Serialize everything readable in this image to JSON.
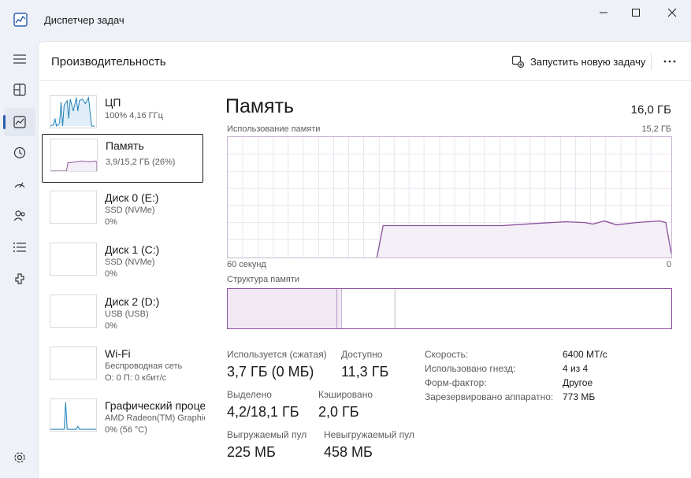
{
  "window": {
    "title": "Диспетчер задач"
  },
  "header": {
    "title": "Производительность",
    "run_task": "Запустить новую задачу"
  },
  "perf_list": [
    {
      "name": "ЦП",
      "sub1": "100%  4,16 ГГц",
      "sub2": ""
    },
    {
      "name": "Память",
      "sub1": "3,9/15,2 ГБ (26%)",
      "sub2": ""
    },
    {
      "name": "Диск 0 (E:)",
      "sub1": "SSD (NVMe)",
      "sub2": "0%"
    },
    {
      "name": "Диск 1 (C:)",
      "sub1": "SSD (NVMe)",
      "sub2": "0%"
    },
    {
      "name": "Диск 2 (D:)",
      "sub1": "USB (USB)",
      "sub2": "0%"
    },
    {
      "name": "Wi-Fi",
      "sub1": "Беспроводная сеть",
      "sub2": "О: 0  П: 0 кбит/с"
    },
    {
      "name": "Графический процессор",
      "sub1": "AMD Radeon(TM) Graphics",
      "sub2": "0%  (56 °C)"
    }
  ],
  "detail": {
    "title": "Память",
    "total": "16,0 ГБ",
    "usage_label": "Использование памяти",
    "usage_max": "15,2 ГБ",
    "time_left": "60 секунд",
    "time_right": "0",
    "composition_label": "Структура памяти",
    "stats": {
      "in_use_label": "Используется (сжатая)",
      "in_use_value": "3,7 ГБ (0 МБ)",
      "available_label": "Доступно",
      "available_value": "11,3 ГБ",
      "committed_label": "Выделено",
      "committed_value": "4,2/18,1 ГБ",
      "cached_label": "Кэшировано",
      "cached_value": "2,0 ГБ",
      "paged_label": "Выгружаемый пул",
      "paged_value": "225 МБ",
      "nonpaged_label": "Невыгружаемый пул",
      "nonpaged_value": "458 МБ"
    },
    "properties": [
      {
        "label": "Скорость:",
        "value": "6400 МТ/с"
      },
      {
        "label": "Использовано гнезд:",
        "value": "4 из 4"
      },
      {
        "label": "Форм-фактор:",
        "value": "Другое"
      },
      {
        "label": "Зарезервировано аппаратно:",
        "value": "773 МБ"
      }
    ]
  },
  "colors": {
    "accent": "#8b4f9e",
    "fill": "#f4eef6",
    "cpu": "#1a7fb8"
  }
}
